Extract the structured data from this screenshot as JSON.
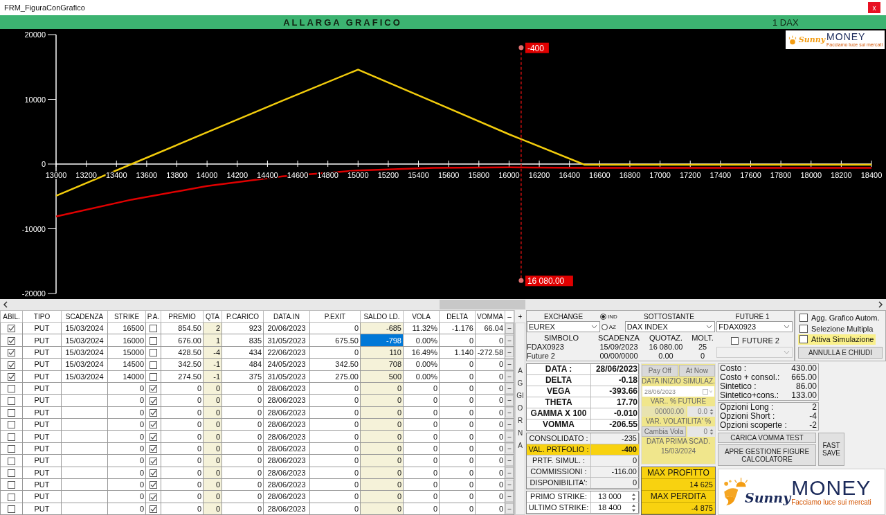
{
  "window": {
    "title": "FRM_FiguraConGrafico",
    "close": "x"
  },
  "header": {
    "title": "ALLARGA GRAFICO",
    "instrument": "1 DAX"
  },
  "chart": {
    "logo": {
      "script": "Sunny",
      "name": "MONEY",
      "tagline": "Facciamo luce sui mercati"
    },
    "chart_data": {
      "type": "line",
      "x": [
        13000,
        13500,
        14000,
        14500,
        15000,
        15500,
        16000,
        16500,
        17000,
        17500,
        18000,
        18400
      ],
      "series": [
        {
          "color": "#f2cc0c",
          "values": [
            -4900,
            0,
            4900,
            9800,
            14600,
            9600,
            4600,
            -100,
            -100,
            -100,
            -100,
            -100
          ]
        },
        {
          "color": "#e00000",
          "values": [
            -8100,
            -5500,
            -3400,
            -1900,
            -1000,
            -600,
            -500,
            -600,
            -600,
            -600,
            -600,
            -600
          ]
        }
      ],
      "xlim": [
        13000,
        18400
      ],
      "ylim": [
        -20000,
        20000
      ],
      "xticks": [
        13000,
        13200,
        13400,
        13600,
        13800,
        14000,
        14200,
        14400,
        14600,
        14800,
        15000,
        15200,
        15400,
        15600,
        15800,
        16000,
        16200,
        16400,
        16600,
        16800,
        17000,
        17200,
        17400,
        17600,
        17800,
        18000,
        18200,
        18400
      ],
      "yticks": [
        -20000,
        -10000,
        0,
        10000,
        20000
      ],
      "ref_lines": [
        {
          "axis": "x",
          "value": 16080
        }
      ],
      "annotations": [
        {
          "x": 16080,
          "y": 18000,
          "text": "-400"
        },
        {
          "x": 16080,
          "y": -18000,
          "text": "16 080.00"
        }
      ]
    }
  },
  "table": {
    "columns": [
      "ABIL.",
      "TIPO",
      "SCADENZA",
      "STRIKE",
      "P.A.",
      "PREMIO",
      "QTA",
      "P.CARICO",
      "DATA.IN",
      "P.EXIT",
      "SALDO LD.",
      "VOLA",
      "DELTA",
      "VOMMA",
      "–",
      "+"
    ],
    "rows": [
      {
        "abil": true,
        "tipo": "PUT",
        "scadenza": "15/03/2024",
        "strike": "16500",
        "pa": false,
        "premio": "854.50",
        "qta": "2",
        "p_carico": "923",
        "data_in": "20/06/2023",
        "p_exit": "0",
        "saldo": "-685",
        "vola": "11.32%",
        "delta": "-1.176",
        "vomma": "66.04",
        "button": "–",
        "selected": false
      },
      {
        "abil": true,
        "tipo": "PUT",
        "scadenza": "15/03/2024",
        "strike": "16000",
        "pa": false,
        "premio": "676.00",
        "qta": "1",
        "p_carico": "835",
        "data_in": "31/05/2023",
        "p_exit": "675.50",
        "saldo": "-798",
        "vola": "0.00%",
        "delta": "0",
        "vomma": "0",
        "button": "–",
        "selected": true
      },
      {
        "abil": true,
        "tipo": "PUT",
        "scadenza": "15/03/2024",
        "strike": "15000",
        "pa": false,
        "premio": "428.50",
        "qta": "-4",
        "p_carico": "434",
        "data_in": "22/06/2023",
        "p_exit": "0",
        "saldo": "110",
        "vola": "16.49%",
        "delta": "1.140",
        "vomma": "-272.58",
        "button": "–",
        "selected": false
      },
      {
        "abil": true,
        "tipo": "PUT",
        "scadenza": "15/03/2024",
        "strike": "14500",
        "pa": false,
        "premio": "342.50",
        "qta": "-1",
        "p_carico": "484",
        "data_in": "24/05/2023",
        "p_exit": "342.50",
        "saldo": "708",
        "vola": "0.00%",
        "delta": "0",
        "vomma": "0",
        "button": "–",
        "selected": false
      },
      {
        "abil": true,
        "tipo": "PUT",
        "scadenza": "15/03/2024",
        "strike": "14000",
        "pa": false,
        "premio": "274.50",
        "qta": "-1",
        "p_carico": "375",
        "data_in": "31/05/2023",
        "p_exit": "275.00",
        "saldo": "500",
        "vola": "0.00%",
        "delta": "0",
        "vomma": "0",
        "button": "–",
        "selected": false
      },
      {
        "abil": false,
        "tipo": "PUT",
        "strike": "0",
        "pa": true,
        "premio": "0",
        "qta": "0",
        "p_carico": "0",
        "data_in": "28/06/2023",
        "p_exit": "0",
        "saldo": "0",
        "vola": "0",
        "delta": "0",
        "vomma": "0",
        "button": "–",
        "selected": false
      },
      {
        "abil": false,
        "tipo": "PUT",
        "strike": "0",
        "pa": true,
        "premio": "0",
        "qta": "0",
        "p_carico": "0",
        "data_in": "28/06/2023",
        "p_exit": "0",
        "saldo": "0",
        "vola": "0",
        "delta": "0",
        "vomma": "0",
        "button": "–",
        "selected": false
      },
      {
        "abil": false,
        "tipo": "PUT",
        "strike": "0",
        "pa": true,
        "premio": "0",
        "qta": "0",
        "p_carico": "0",
        "data_in": "28/06/2023",
        "p_exit": "0",
        "saldo": "0",
        "vola": "0",
        "delta": "0",
        "vomma": "0",
        "button": "–",
        "selected": false
      },
      {
        "abil": false,
        "tipo": "PUT",
        "strike": "0",
        "pa": true,
        "premio": "0",
        "qta": "0",
        "p_carico": "0",
        "data_in": "28/06/2023",
        "p_exit": "0",
        "saldo": "0",
        "vola": "0",
        "delta": "0",
        "vomma": "0",
        "button": "–",
        "selected": false
      },
      {
        "abil": false,
        "tipo": "PUT",
        "strike": "0",
        "pa": true,
        "premio": "0",
        "qta": "0",
        "p_carico": "0",
        "data_in": "28/06/2023",
        "p_exit": "0",
        "saldo": "0",
        "vola": "0",
        "delta": "0",
        "vomma": "0",
        "button": "–",
        "selected": false
      },
      {
        "abil": false,
        "tipo": "PUT",
        "strike": "0",
        "pa": true,
        "premio": "0",
        "qta": "0",
        "p_carico": "0",
        "data_in": "28/06/2023",
        "p_exit": "0",
        "saldo": "0",
        "vola": "0",
        "delta": "0",
        "vomma": "0",
        "button": "–",
        "selected": false
      },
      {
        "abil": false,
        "tipo": "PUT",
        "strike": "0",
        "pa": true,
        "premio": "0",
        "qta": "0",
        "p_carico": "0",
        "data_in": "28/06/2023",
        "p_exit": "0",
        "saldo": "0",
        "vola": "0",
        "delta": "0",
        "vomma": "0",
        "button": "–",
        "selected": false
      },
      {
        "abil": false,
        "tipo": "PUT",
        "strike": "0",
        "pa": true,
        "premio": "0",
        "qta": "0",
        "p_carico": "0",
        "data_in": "28/06/2023",
        "p_exit": "0",
        "saldo": "0",
        "vola": "0",
        "delta": "0",
        "vomma": "0",
        "button": "–",
        "selected": false
      },
      {
        "abil": false,
        "tipo": "PUT",
        "strike": "0",
        "pa": true,
        "premio": "0",
        "qta": "0",
        "p_carico": "0",
        "data_in": "28/06/2023",
        "p_exit": "0",
        "saldo": "0",
        "vola": "0",
        "delta": "0",
        "vomma": "0",
        "button": "–",
        "selected": false
      },
      {
        "abil": false,
        "tipo": "PUT",
        "strike": "0",
        "pa": true,
        "premio": "0",
        "qta": "0",
        "p_carico": "0",
        "data_in": "28/06/2023",
        "p_exit": "0",
        "saldo": "0",
        "vola": "0",
        "delta": "0",
        "vomma": "0",
        "button": "–",
        "selected": false
      },
      {
        "abil": false,
        "tipo": "PUT",
        "strike": "0",
        "pa": true,
        "premio": "0",
        "qta": "0",
        "p_carico": "0",
        "data_in": "28/06/2023",
        "p_exit": "0",
        "saldo": "0",
        "vola": "0",
        "delta": "0",
        "vomma": "0",
        "button": "–",
        "selected": false
      }
    ]
  },
  "refresh_button": "AGGIORNA",
  "underlying": {
    "exchange_label": "EXCHANGE",
    "exchange": "EUREX",
    "market_options": [
      {
        "label": "IND",
        "selected": true
      },
      {
        "label": "AZ",
        "selected": false
      }
    ],
    "underlying_label": "SOTTOSTANTE",
    "underlying": "DAX INDEX",
    "future1_label": "FUTURE 1",
    "future1": "FDAX0923",
    "future2": {
      "label": "FUTURE 2",
      "checked": false
    },
    "info_columns": [
      "SIMBOLO",
      "SCADENZA",
      "QUOTAZ.",
      "MOLT."
    ],
    "info_rows": [
      [
        "FDAX0923",
        "15/09/2023",
        "16 080.00",
        "25"
      ],
      [
        "Future 2",
        "00/00/0000",
        "0.00",
        "0"
      ]
    ]
  },
  "options": [
    {
      "label": "Agg. Grafico Autom.",
      "checked": false,
      "highlighted": false
    },
    {
      "label": "Selezione Multipla",
      "checked": false,
      "highlighted": false
    },
    {
      "label": "Attiva Simulazione",
      "checked": false,
      "highlighted": true
    }
  ],
  "close_button": "ANNULLA E CHIUDI",
  "greeks": [
    {
      "label": "DATA :",
      "value": "28/06/2023"
    },
    {
      "label": "DELTA",
      "value": "-0.18"
    },
    {
      "label": "VEGA",
      "value": "-393.66"
    },
    {
      "label": "THETA",
      "value": "17.70"
    },
    {
      "label": "GAMMA X 100",
      "value": "-0.010"
    },
    {
      "label": "VOMMA",
      "value": "-206.55"
    }
  ],
  "portfolio": [
    {
      "label": "CONSOLIDATO :",
      "value": "-235",
      "highlighted": false
    },
    {
      "label": "VAL. PRTFOLIO :",
      "value": "-400",
      "highlighted": true
    },
    {
      "label": "PRTF. SIMUL. :",
      "value": "0",
      "highlighted": false
    },
    {
      "label": "COMMISSIONI :",
      "value": "-116.00",
      "highlighted": false
    },
    {
      "label": "DISPONIBILITA':",
      "value": "0",
      "highlighted": false
    }
  ],
  "strikes": [
    {
      "label": "PRIMO STRIKE:",
      "value": "13 000"
    },
    {
      "label": "ULTIMO STRIKE:",
      "value": "18 400"
    }
  ],
  "simulation": {
    "buttons": [
      "Pay Off",
      "At Now"
    ],
    "start_label": "DATA INIZIO SIMULAZ.",
    "start_date": "28/06/2023",
    "future_label": "VAR.. % FUTURE",
    "future_value": "00000.00",
    "future_step": "0.0",
    "vol_label": "VAR. VOLATILITA' %",
    "vol_button": "Cambia Vola",
    "vol_step": "0",
    "first_expiry_label": "DATA PRIMA SCAD.",
    "first_expiry": "15/03/2024"
  },
  "results": [
    {
      "label": "MAX PROFITTO",
      "value": "14 625"
    },
    {
      "label": "MAX PERDITA",
      "value": "-4 875"
    }
  ],
  "costs": [
    {
      "label": "Costo :",
      "value": "430.00"
    },
    {
      "label": "Costo + consol.:",
      "value": "665.00"
    },
    {
      "label": "Sintetico :",
      "value": "86.00"
    },
    {
      "label": "Sintetico+cons.:",
      "value": "133.00"
    }
  ],
  "counts": [
    {
      "label": "Opzioni Long :",
      "value": "2"
    },
    {
      "label": "Opzioni Short :",
      "value": "-4"
    },
    {
      "label": "Opzioni scoperte :",
      "value": "-2"
    }
  ],
  "buttons": {
    "vomma": "CARICA VOMMA TEST",
    "figures": "APRE GESTIONE FIGURE CALCOLATORE",
    "save": "FAST SAVE"
  },
  "logo": {
    "script": "Sunny",
    "name": "MONEY",
    "tagline": "Facciamo luce sui mercati"
  }
}
